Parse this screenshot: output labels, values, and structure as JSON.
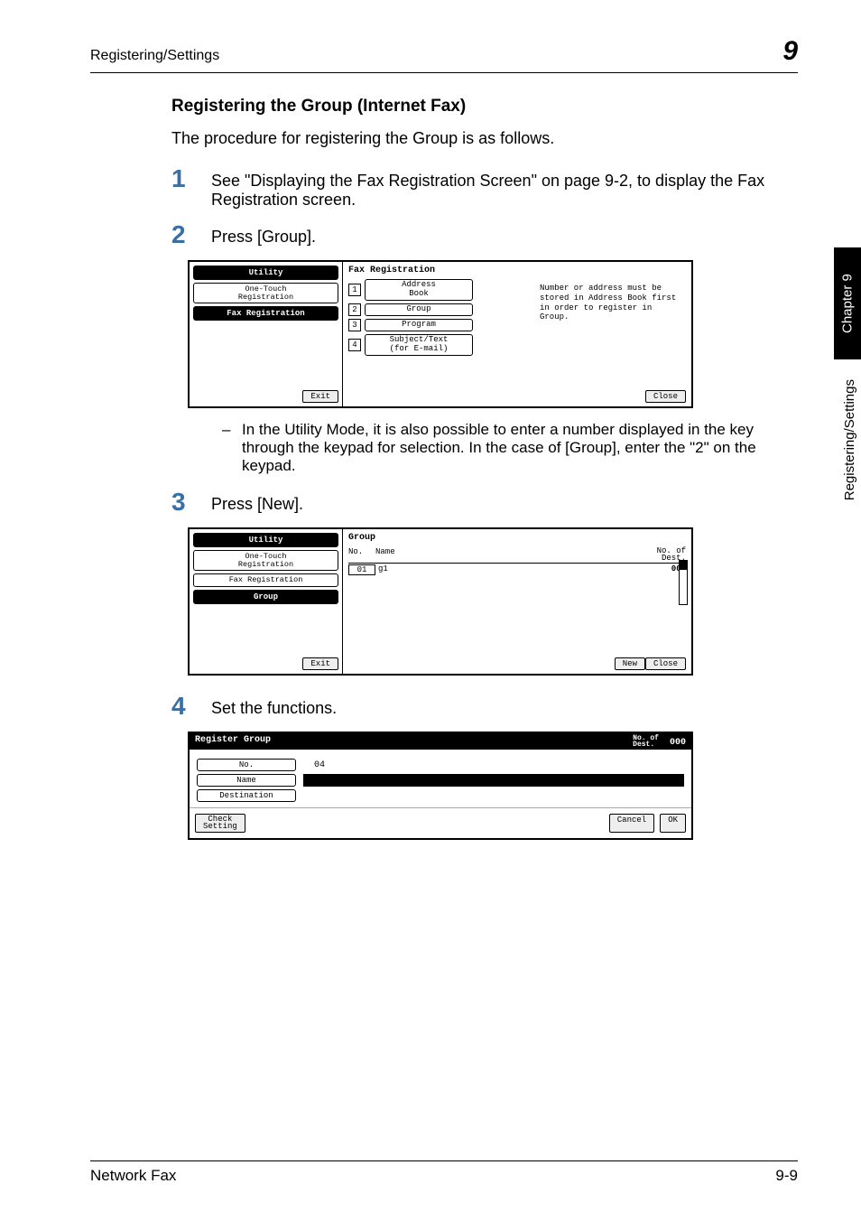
{
  "header": {
    "left": "Registering/Settings",
    "right": "9"
  },
  "section_title": "Registering the Group (Internet Fax)",
  "intro": "The procedure for registering the Group is as follows.",
  "steps": {
    "s1": {
      "num": "1",
      "text": "See \"Displaying the Fax Registration Screen\" on page 9-2, to display the Fax Registration screen."
    },
    "s2": {
      "num": "2",
      "text": "Press [Group]."
    },
    "s2note": "In the Utility Mode, it is also possible to enter a number displayed in the key through the keypad for selection. In the case of [Group], enter the \"2\" on the keypad.",
    "s3": {
      "num": "3",
      "text": "Press [New]."
    },
    "s4": {
      "num": "4",
      "text": "Set the functions."
    }
  },
  "screen1": {
    "util": "Utility",
    "onetouch": "One-Touch\nRegistration",
    "faxreg": "Fax Registration",
    "title": "Fax Registration",
    "opts": [
      {
        "n": "1",
        "l": "Address\nBook"
      },
      {
        "n": "2",
        "l": "Group"
      },
      {
        "n": "3",
        "l": "Program"
      },
      {
        "n": "4",
        "l": "Subject/Text\n(for E-mail)"
      }
    ],
    "msg": "Number or address must be stored in Address Book first in order to register in Group.",
    "exit": "Exit",
    "close": "Close"
  },
  "screen2": {
    "util": "Utility",
    "onetouch": "One-Touch\nRegistration",
    "faxreg": "Fax Registration",
    "group": "Group",
    "title": "Group",
    "col_no": "No.",
    "col_name": "Name",
    "col_dest": "No. of\nDest.",
    "row_no": "01",
    "row_name": "g1",
    "row_dest": "003",
    "scroll_top": "1",
    "scroll_bot": "1",
    "exit": "Exit",
    "new": "New",
    "close": "Close"
  },
  "screen3": {
    "title": "Register Group",
    "dest_label": "No. of\nDest.",
    "dest_val": "000",
    "no_label": "No.",
    "no_val": "04",
    "name_label": "Name",
    "dest_btn": "Destination",
    "check": "Check\nSetting",
    "cancel": "Cancel",
    "ok": "OK"
  },
  "side": {
    "tab": "Chapter 9",
    "label": "Registering/Settings"
  },
  "footer": {
    "left": "Network Fax",
    "right": "9-9"
  }
}
